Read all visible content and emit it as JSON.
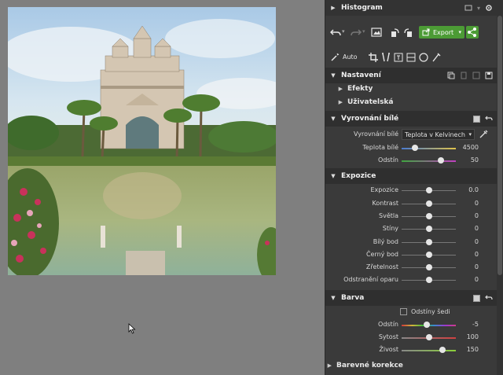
{
  "panel": {
    "histogram_title": "Histogram",
    "auto_label": "Auto",
    "export_label": "Export",
    "sections": {
      "nastaveni": "Nastavení",
      "efekty": "Efekty",
      "uzivatelska": "Uživatelská",
      "white_balance": "Vyrovnání bílé",
      "exposure": "Expozice",
      "color": "Barva",
      "color_correction": "Barevné korekce"
    },
    "white_balance": {
      "mode_label": "Vyrovnání bílé",
      "mode_value": "Teplota v Kelvinech",
      "sliders": [
        {
          "label": "Teplota bílé",
          "value": "4500",
          "pos": 0.25
        },
        {
          "label": "Odstín",
          "value": "50",
          "pos": 0.72
        }
      ]
    },
    "exposure": {
      "sliders": [
        {
          "label": "Expozice",
          "value": "0.0",
          "pos": 0.5
        },
        {
          "label": "Kontrast",
          "value": "0",
          "pos": 0.5
        },
        {
          "label": "Světla",
          "value": "0",
          "pos": 0.5
        },
        {
          "label": "Stíny",
          "value": "0",
          "pos": 0.5
        },
        {
          "label": "Bílý bod",
          "value": "0",
          "pos": 0.5
        },
        {
          "label": "Černý bod",
          "value": "0",
          "pos": 0.5
        },
        {
          "label": "Zřetelnost",
          "value": "0",
          "pos": 0.5
        },
        {
          "label": "Odstranění oparu",
          "value": "0",
          "pos": 0.5
        }
      ]
    },
    "color": {
      "grayscale_label": "Odstíny šedi",
      "sliders": [
        {
          "label": "Odstín",
          "value": "-5",
          "pos": 0.47
        },
        {
          "label": "Sytost",
          "value": "100",
          "pos": 0.5
        },
        {
          "label": "Živost",
          "value": "150",
          "pos": 0.75
        }
      ]
    }
  },
  "colors": {
    "accent_green": "#4c9b35",
    "panel_bg": "#3a3a3a",
    "canvas_bg": "#7f7f7f"
  }
}
